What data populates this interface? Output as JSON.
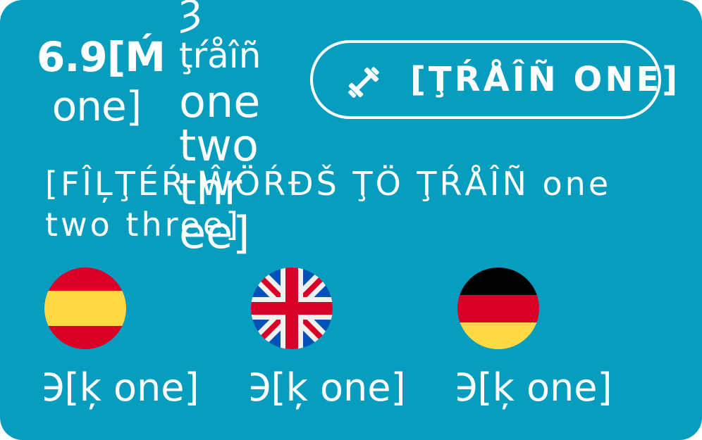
{
  "stats": {
    "value": "6.9[Ḿ",
    "unit": "one]"
  },
  "label_column": [
    "ȝ",
    "ţŕåîñ",
    "one",
    "two",
    "thr",
    "ee]"
  ],
  "train_button": {
    "label": "[ŢŔÅÎÑ ONE]",
    "icon": "dumbbell-icon"
  },
  "filter_text": "[FÎĻŢÉŔ ŴÖŔĐŠ ŢÖ ŢŔÅÎÑ one two three]",
  "languages": [
    {
      "flag": "spain-flag-icon",
      "label": "Ə[ķ one]"
    },
    {
      "flag": "uk-flag-icon",
      "label": "Ə[ķ one]"
    },
    {
      "flag": "germany-flag-icon",
      "label": "Ə[ķ one]"
    }
  ],
  "colors": {
    "background": "#079DBF",
    "text": "#FFFFFF"
  }
}
